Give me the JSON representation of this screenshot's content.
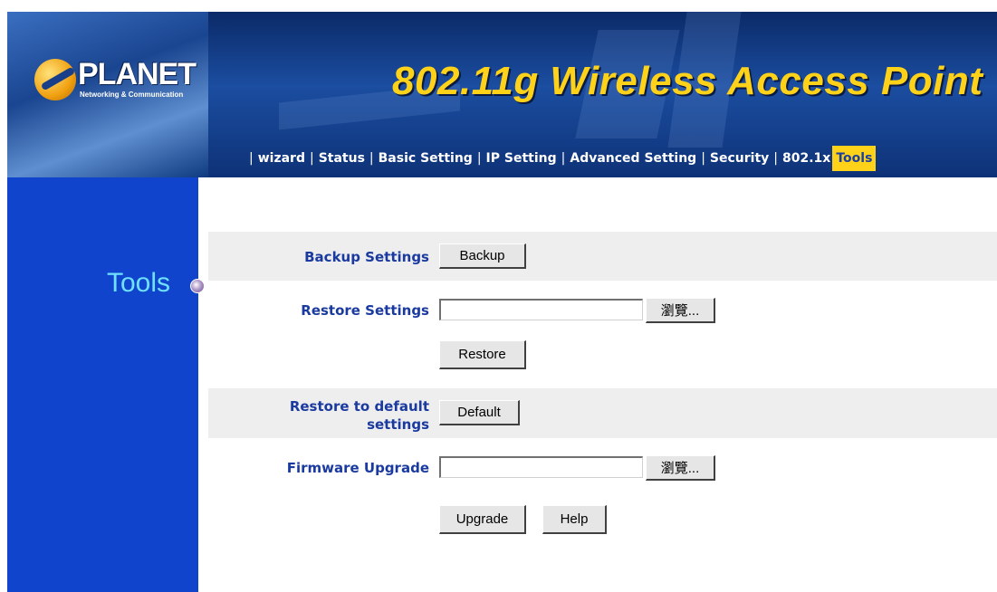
{
  "brand": {
    "logo_text": "PLANET",
    "logo_subtext": "Networking & Communication",
    "product_title": "802.11g Wireless Access Point"
  },
  "nav": {
    "items": [
      {
        "label": "wizard"
      },
      {
        "label": "Status"
      },
      {
        "label": "Basic  Setting"
      },
      {
        "label": "IP Setting"
      },
      {
        "label": "Advanced Setting"
      },
      {
        "label": "Security"
      },
      {
        "label": "802.1x"
      },
      {
        "label": "Tools",
        "active": true
      }
    ],
    "separator": "|"
  },
  "sidebar": {
    "title": "Tools"
  },
  "form": {
    "backup": {
      "label": "Backup Settings",
      "button": "Backup"
    },
    "restore": {
      "label": "Restore Settings",
      "file_value": "",
      "browse": "瀏覽...",
      "button": "Restore"
    },
    "default": {
      "label_line1": "Restore to default",
      "label_line2": "settings",
      "button": "Default"
    },
    "firmware": {
      "label": "Firmware Upgrade",
      "file_value": "",
      "browse": "瀏覽...",
      "upgrade": "Upgrade",
      "help": "Help"
    }
  },
  "colors": {
    "header_bg": "#0e3277",
    "title_yellow": "#ffd21a",
    "sidebar_bg": "#1144cc",
    "sidebar_title": "#6fe0ff",
    "label_blue": "#1a3aa0",
    "row_shade": "#eeeeee"
  }
}
